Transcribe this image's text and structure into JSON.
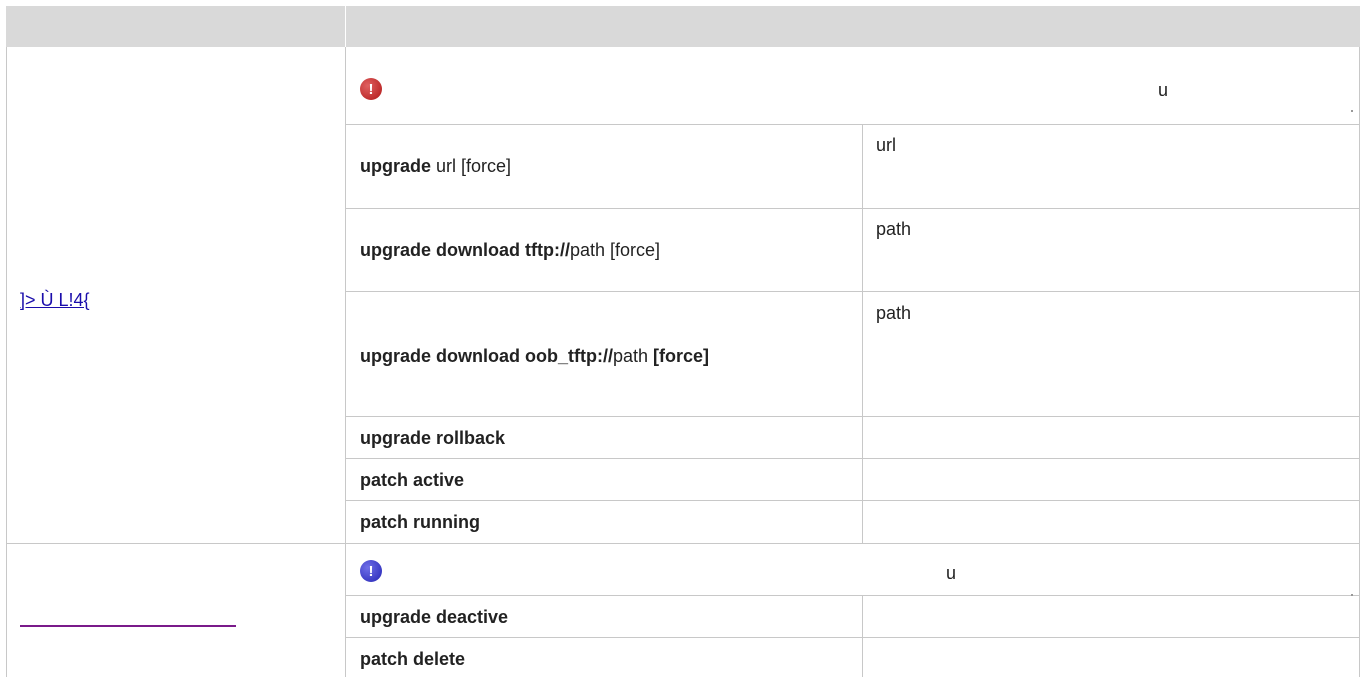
{
  "header": {
    "col1": "",
    "col2": ""
  },
  "section1": {
    "link_text": "]>  Ù  L!4{",
    "note_glyph": "u",
    "rows": [
      {
        "cmd_bold": "upgrade",
        "cmd_rest": " url    [force]",
        "desc": "url"
      },
      {
        "cmd_bold": "upgrade download tftp://",
        "cmd_rest": "path [force]",
        "desc": "path"
      },
      {
        "cmd_bold": "upgrade download oob_tftp://",
        "cmd_rest": "path ",
        "cmd_bold2": "[force]",
        "desc": "path"
      },
      {
        "cmd_bold": "upgrade rollback",
        "desc": ""
      },
      {
        "cmd_bold": "patch active",
        "desc": ""
      },
      {
        "cmd_bold": "patch running",
        "desc": ""
      }
    ]
  },
  "section2": {
    "note_glyph": "u",
    "rows": [
      {
        "cmd_bold": "upgrade deactive",
        "desc": ""
      },
      {
        "cmd_bold": "patch delete",
        "desc": ""
      }
    ]
  },
  "icons": {
    "warning": "exclamation-icon",
    "info": "exclamation-icon"
  },
  "colors": {
    "header_bg": "#d9d9d9",
    "warning_red": "#b01818",
    "info_blue": "#2424b4",
    "link_blue": "#1a0dab",
    "link_violet": "#7a1a8a"
  }
}
